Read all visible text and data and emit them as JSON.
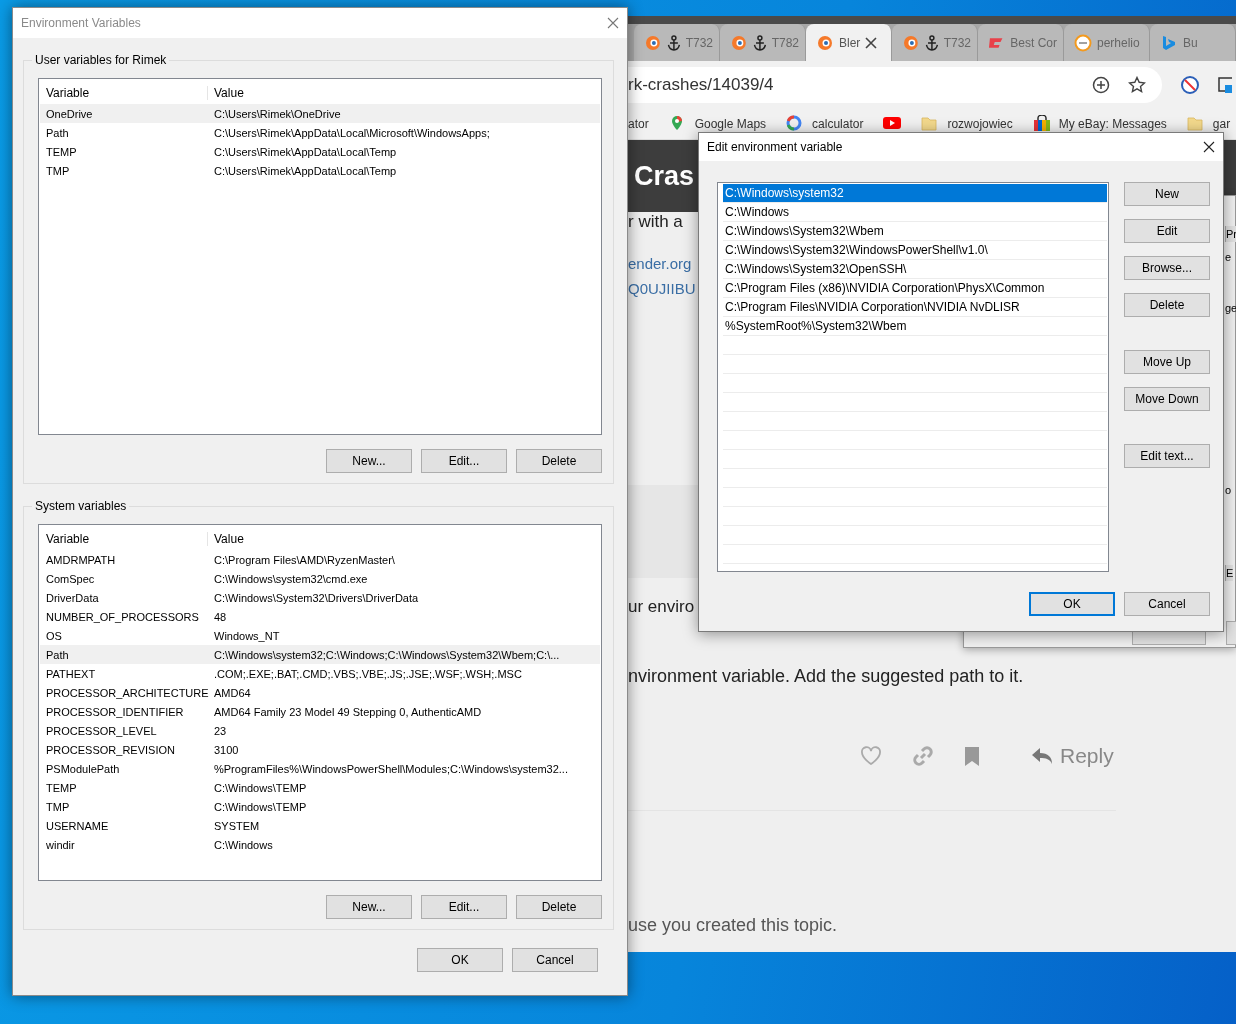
{
  "browser": {
    "tabs": [
      {
        "label": "T732",
        "selected": false,
        "kind": "task"
      },
      {
        "label": "T782",
        "selected": false,
        "kind": "task"
      },
      {
        "label": "Bler",
        "selected": true,
        "kind": "blender"
      },
      {
        "label": "T732",
        "selected": false,
        "kind": "task"
      },
      {
        "label": "Best Cor",
        "selected": false,
        "kind": "game"
      },
      {
        "label": "perhelio",
        "selected": false,
        "kind": "clock"
      },
      {
        "label": "Bu",
        "selected": false,
        "kind": "bing"
      }
    ],
    "address": "rk-crashes/14039/4",
    "bookmarks": [
      {
        "label": "ator",
        "kind": "plain"
      },
      {
        "label": "Google Maps",
        "kind": "maps"
      },
      {
        "label": "calculator",
        "kind": "google"
      },
      {
        "kind": "video"
      },
      {
        "label": "rozwojowiec",
        "kind": "folder"
      },
      {
        "label": "My eBay: Messages",
        "kind": "shop"
      },
      {
        "label": "gar",
        "kind": "folder"
      }
    ],
    "page": {
      "heading": "Cras",
      "intro": "r with a",
      "links": [
        "ender.org",
        "Q0UJIIBU"
      ],
      "lines": [
        "ur enviro",
        "nvironment variable. Add the suggested path to it."
      ],
      "reply": "Reply",
      "note": "use you created this topic."
    }
  },
  "back_dialog": {
    "side_labels": [
      "Pr",
      "e",
      "ge",
      "o",
      "E"
    ]
  },
  "env": {
    "title": "Environment Variables",
    "user": {
      "title": "User variables for Rimek",
      "columns": [
        "Variable",
        "Value"
      ],
      "rows": [
        {
          "variable": "OneDrive",
          "value": "C:\\Users\\Rimek\\OneDrive",
          "selected": true
        },
        {
          "variable": "Path",
          "value": "C:\\Users\\Rimek\\AppData\\Local\\Microsoft\\WindowsApps;",
          "selected": false
        },
        {
          "variable": "TEMP",
          "value": "C:\\Users\\Rimek\\AppData\\Local\\Temp",
          "selected": false
        },
        {
          "variable": "TMP",
          "value": "C:\\Users\\Rimek\\AppData\\Local\\Temp",
          "selected": false
        }
      ],
      "buttons": [
        "New...",
        "Edit...",
        "Delete"
      ]
    },
    "system": {
      "title": "System variables",
      "columns": [
        "Variable",
        "Value"
      ],
      "rows": [
        {
          "variable": "AMDRMPATH",
          "value": "C:\\Program Files\\AMD\\RyzenMaster\\",
          "selected": false
        },
        {
          "variable": "ComSpec",
          "value": "C:\\Windows\\system32\\cmd.exe",
          "selected": false
        },
        {
          "variable": "DriverData",
          "value": "C:\\Windows\\System32\\Drivers\\DriverData",
          "selected": false
        },
        {
          "variable": "NUMBER_OF_PROCESSORS",
          "value": "48",
          "selected": false
        },
        {
          "variable": "OS",
          "value": "Windows_NT",
          "selected": false
        },
        {
          "variable": "Path",
          "value": "C:\\Windows\\system32;C:\\Windows;C:\\Windows\\System32\\Wbem;C:\\...",
          "selected": true
        },
        {
          "variable": "PATHEXT",
          "value": ".COM;.EXE;.BAT;.CMD;.VBS;.VBE;.JS;.JSE;.WSF;.WSH;.MSC",
          "selected": false
        },
        {
          "variable": "PROCESSOR_ARCHITECTURE",
          "value": "AMD64",
          "selected": false
        },
        {
          "variable": "PROCESSOR_IDENTIFIER",
          "value": "AMD64 Family 23 Model 49 Stepping 0, AuthenticAMD",
          "selected": false
        },
        {
          "variable": "PROCESSOR_LEVEL",
          "value": "23",
          "selected": false
        },
        {
          "variable": "PROCESSOR_REVISION",
          "value": "3100",
          "selected": false
        },
        {
          "variable": "PSModulePath",
          "value": "%ProgramFiles%\\WindowsPowerShell\\Modules;C:\\Windows\\system32...",
          "selected": false
        },
        {
          "variable": "TEMP",
          "value": "C:\\Windows\\TEMP",
          "selected": false
        },
        {
          "variable": "TMP",
          "value": "C:\\Windows\\TEMP",
          "selected": false
        },
        {
          "variable": "USERNAME",
          "value": "SYSTEM",
          "selected": false
        },
        {
          "variable": "windir",
          "value": "C:\\Windows",
          "selected": false
        }
      ],
      "buttons": [
        "New...",
        "Edit...",
        "Delete"
      ]
    },
    "buttons": [
      "OK",
      "Cancel"
    ]
  },
  "edit": {
    "title": "Edit environment variable",
    "entries": [
      {
        "text": "C:\\Windows\\system32",
        "selected": true
      },
      {
        "text": "C:\\Windows",
        "selected": false
      },
      {
        "text": "C:\\Windows\\System32\\Wbem",
        "selected": false
      },
      {
        "text": "C:\\Windows\\System32\\WindowsPowerShell\\v1.0\\",
        "selected": false
      },
      {
        "text": "C:\\Windows\\System32\\OpenSSH\\",
        "selected": false
      },
      {
        "text": "C:\\Program Files (x86)\\NVIDIA Corporation\\PhysX\\Common",
        "selected": false
      },
      {
        "text": "C:\\Program Files\\NVIDIA Corporation\\NVIDIA NvDLISR",
        "selected": false
      },
      {
        "text": "%SystemRoot%\\System32\\Wbem",
        "selected": false
      }
    ],
    "button_groups": [
      [
        "New",
        "Edit",
        "Browse...",
        "Delete"
      ],
      [
        "Move Up",
        "Move Down"
      ],
      [
        "Edit text..."
      ]
    ],
    "footer": [
      {
        "label": "OK",
        "default": true
      },
      {
        "label": "Cancel",
        "default": false
      }
    ]
  }
}
